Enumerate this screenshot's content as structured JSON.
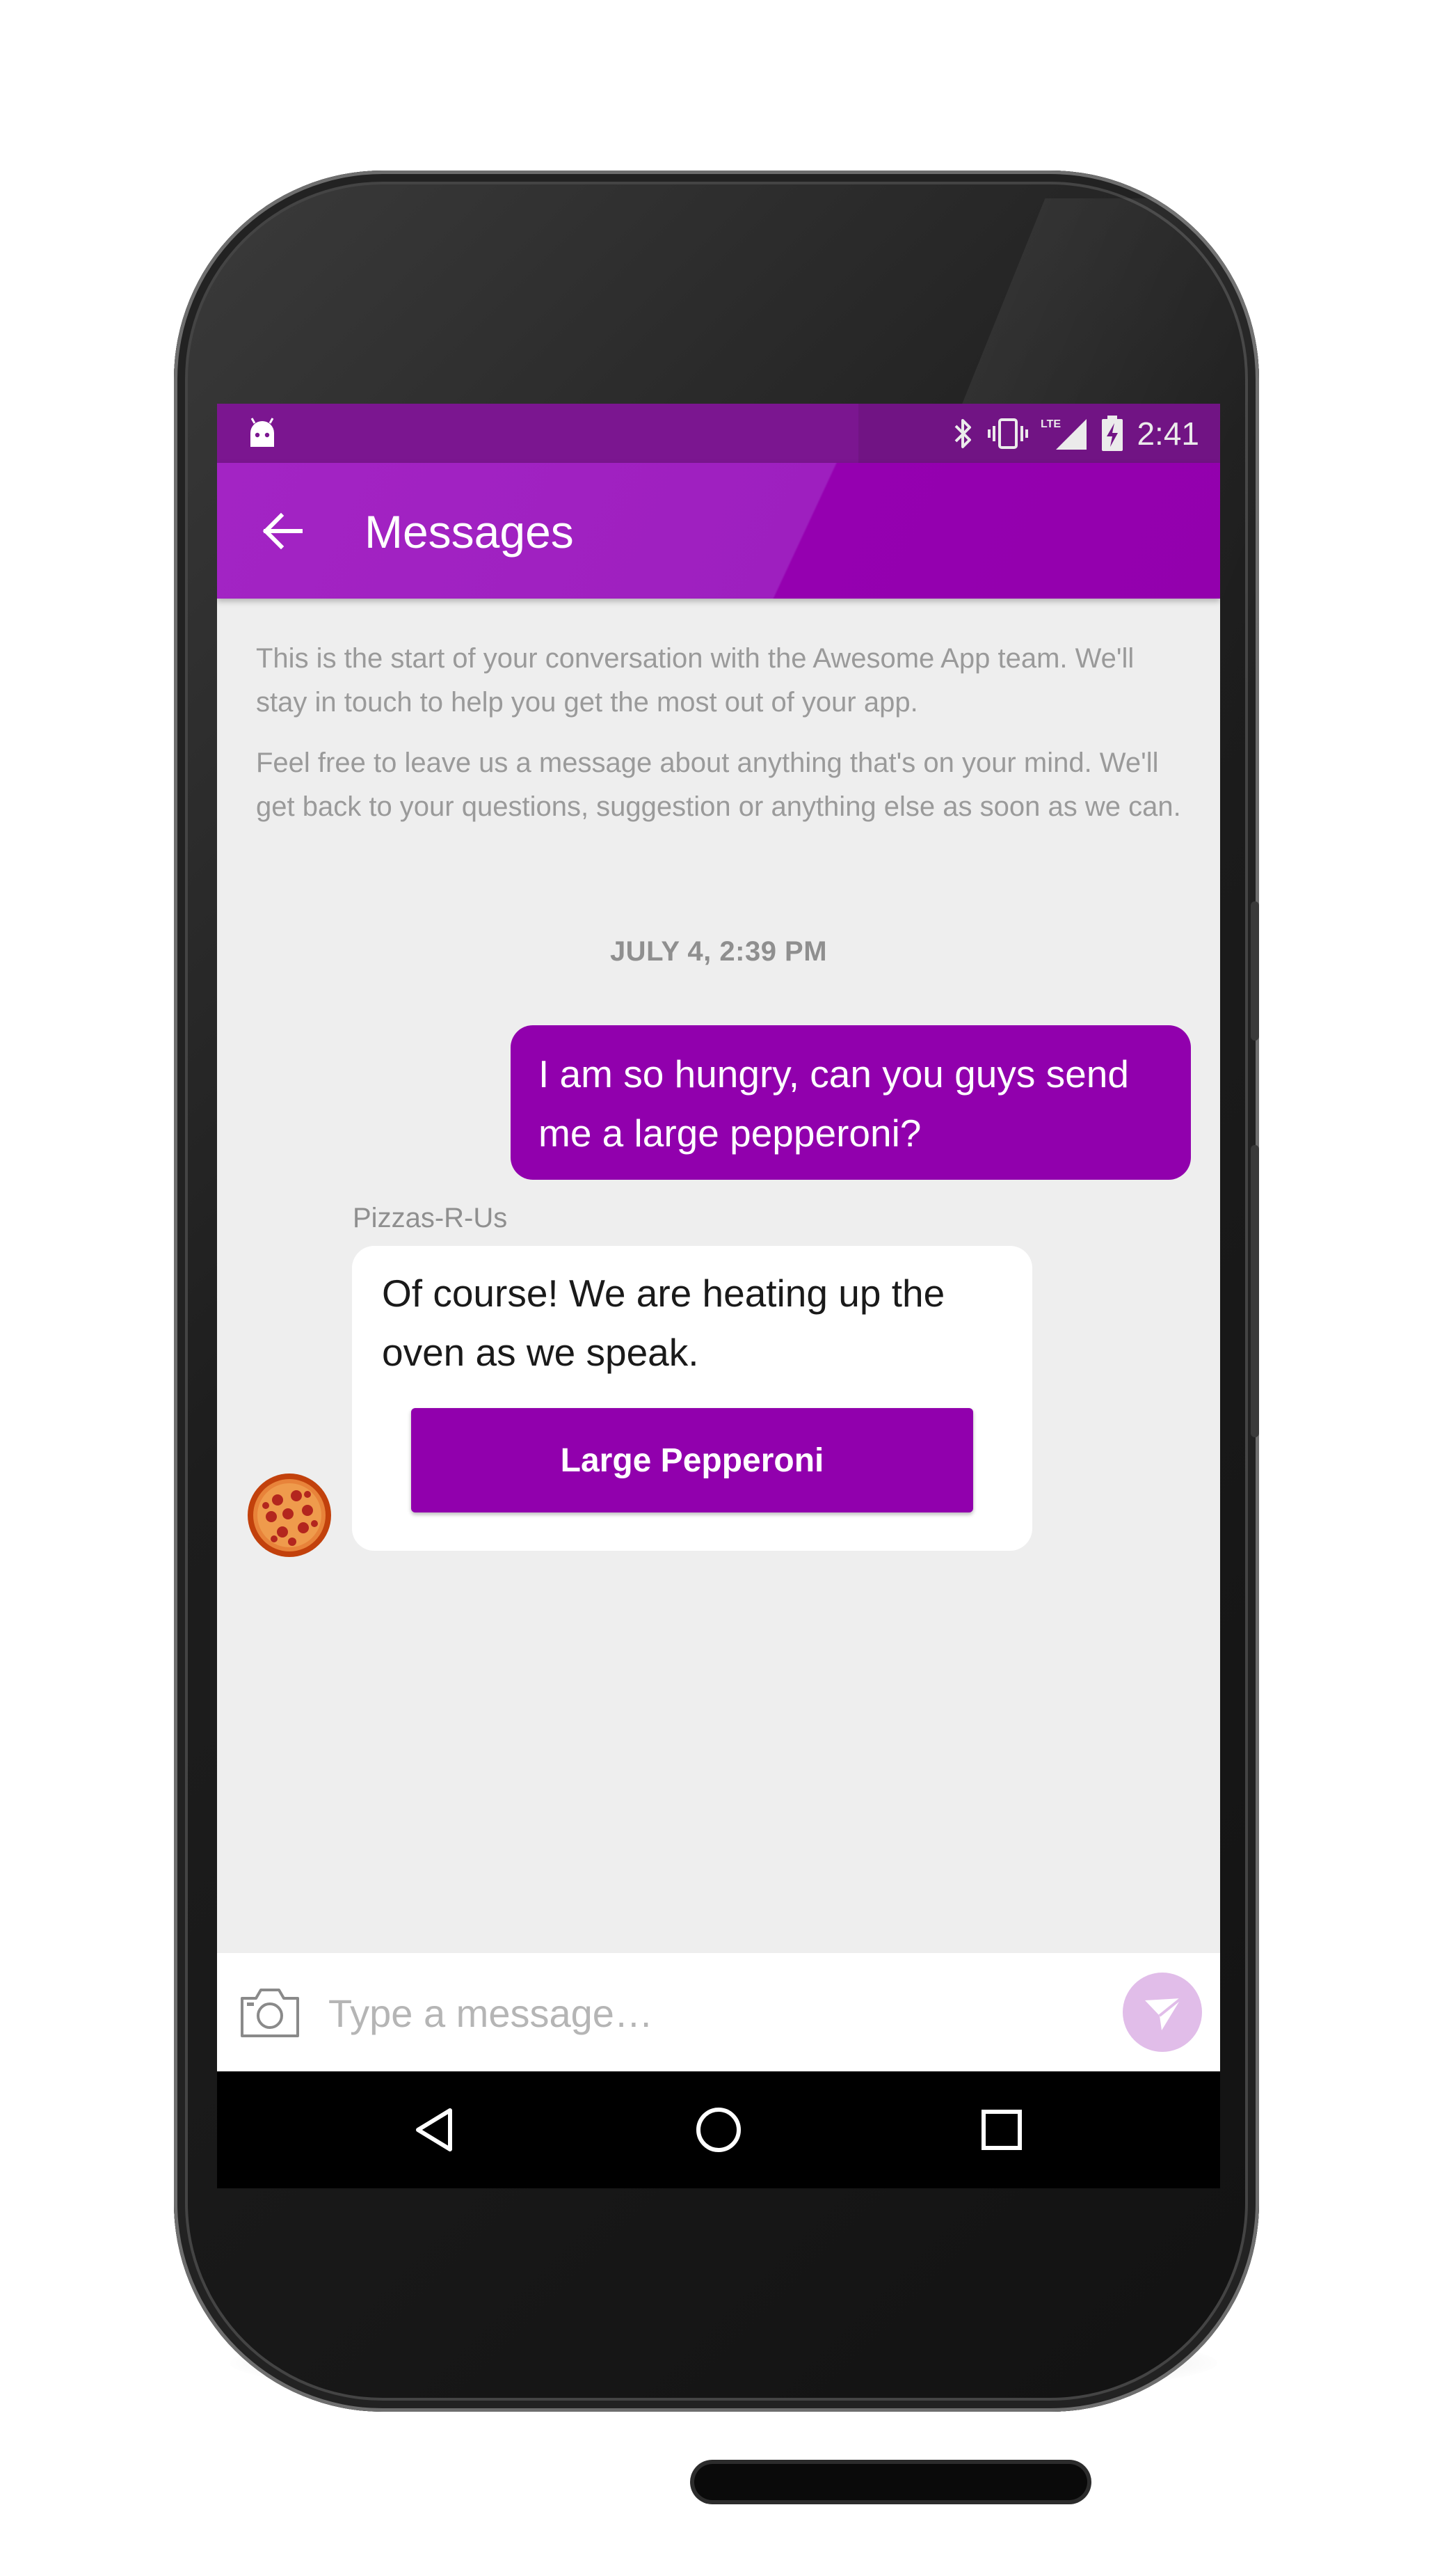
{
  "status_bar": {
    "time": "2:41",
    "network": "LTE",
    "icons": [
      "android-debug-icon",
      "bluetooth-icon",
      "vibrate-icon",
      "lte-signal-icon",
      "battery-charging-icon"
    ]
  },
  "app_bar": {
    "title": "Messages",
    "back_icon": "arrow-back-icon"
  },
  "conversation": {
    "intro": [
      "This is the start of your conversation with the Awesome App team. We'll stay in touch to help you get the most out of your app.",
      "Feel free to leave us a message about anything that's on your mind. We'll get back to your questions, suggestion or anything else as soon as we can."
    ],
    "date": "JULY 4, 2:39 PM",
    "messages": [
      {
        "from": "user",
        "text": "I am so hungry, can you guys send me a large pepperoni?"
      },
      {
        "from": "bot",
        "sender": "Pizzas-R-Us",
        "text": "Of course! We are heating up the oven as we speak.",
        "quick_reply": "Large Pepperoni"
      }
    ]
  },
  "composer": {
    "placeholder": "Type a message…",
    "camera_icon": "camera-icon",
    "send_icon": "send-icon"
  },
  "nav": {
    "buttons": [
      "back-triangle-icon",
      "home-circle-icon",
      "recents-square-icon"
    ]
  },
  "colors": {
    "accent": "#9100AD",
    "status_bar": "#7B1690",
    "send_button": "#E1BDE9",
    "background": "#EEEEEE"
  }
}
